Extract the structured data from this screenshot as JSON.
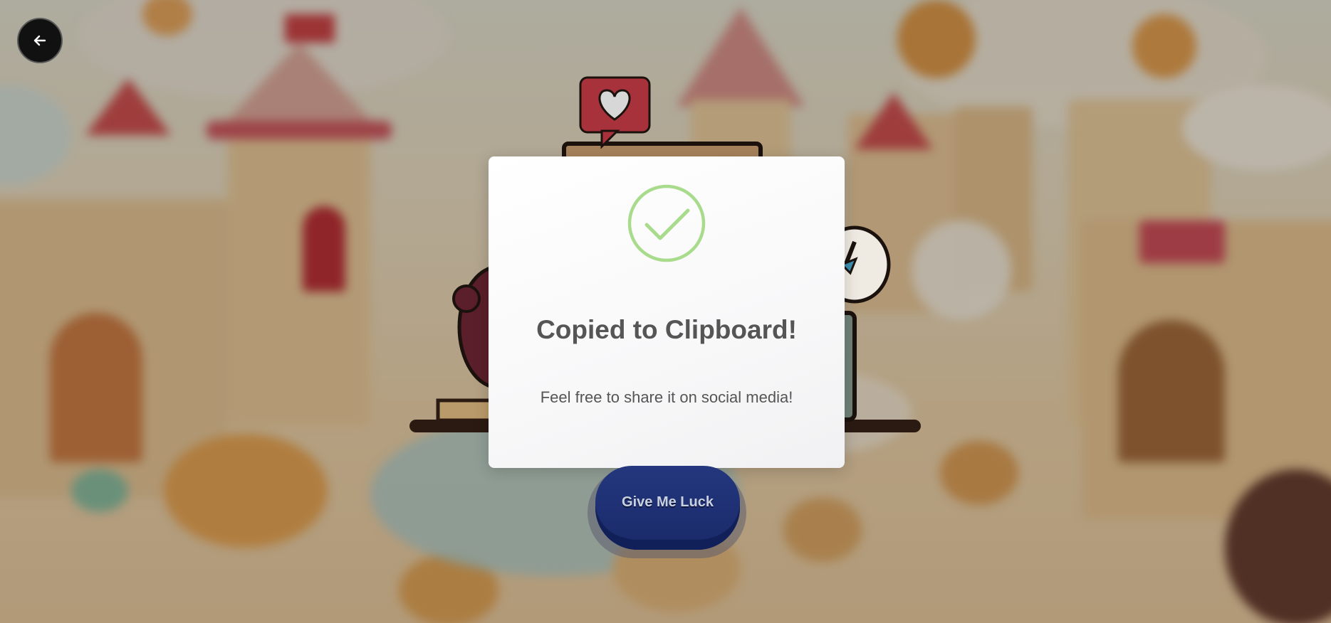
{
  "nav": {
    "back_icon": "arrow-left-icon"
  },
  "dialog": {
    "icon": "check-circle-icon",
    "title": "Copied to Clipboard!",
    "message": "Feel free to share it on social media!",
    "accent_color": "#a8dc8c"
  },
  "actions": {
    "luck_label": "Give Me Luck"
  },
  "colors": {
    "overlay": "rgba(60,45,30,0.30)",
    "button": "#1a2b6b"
  }
}
